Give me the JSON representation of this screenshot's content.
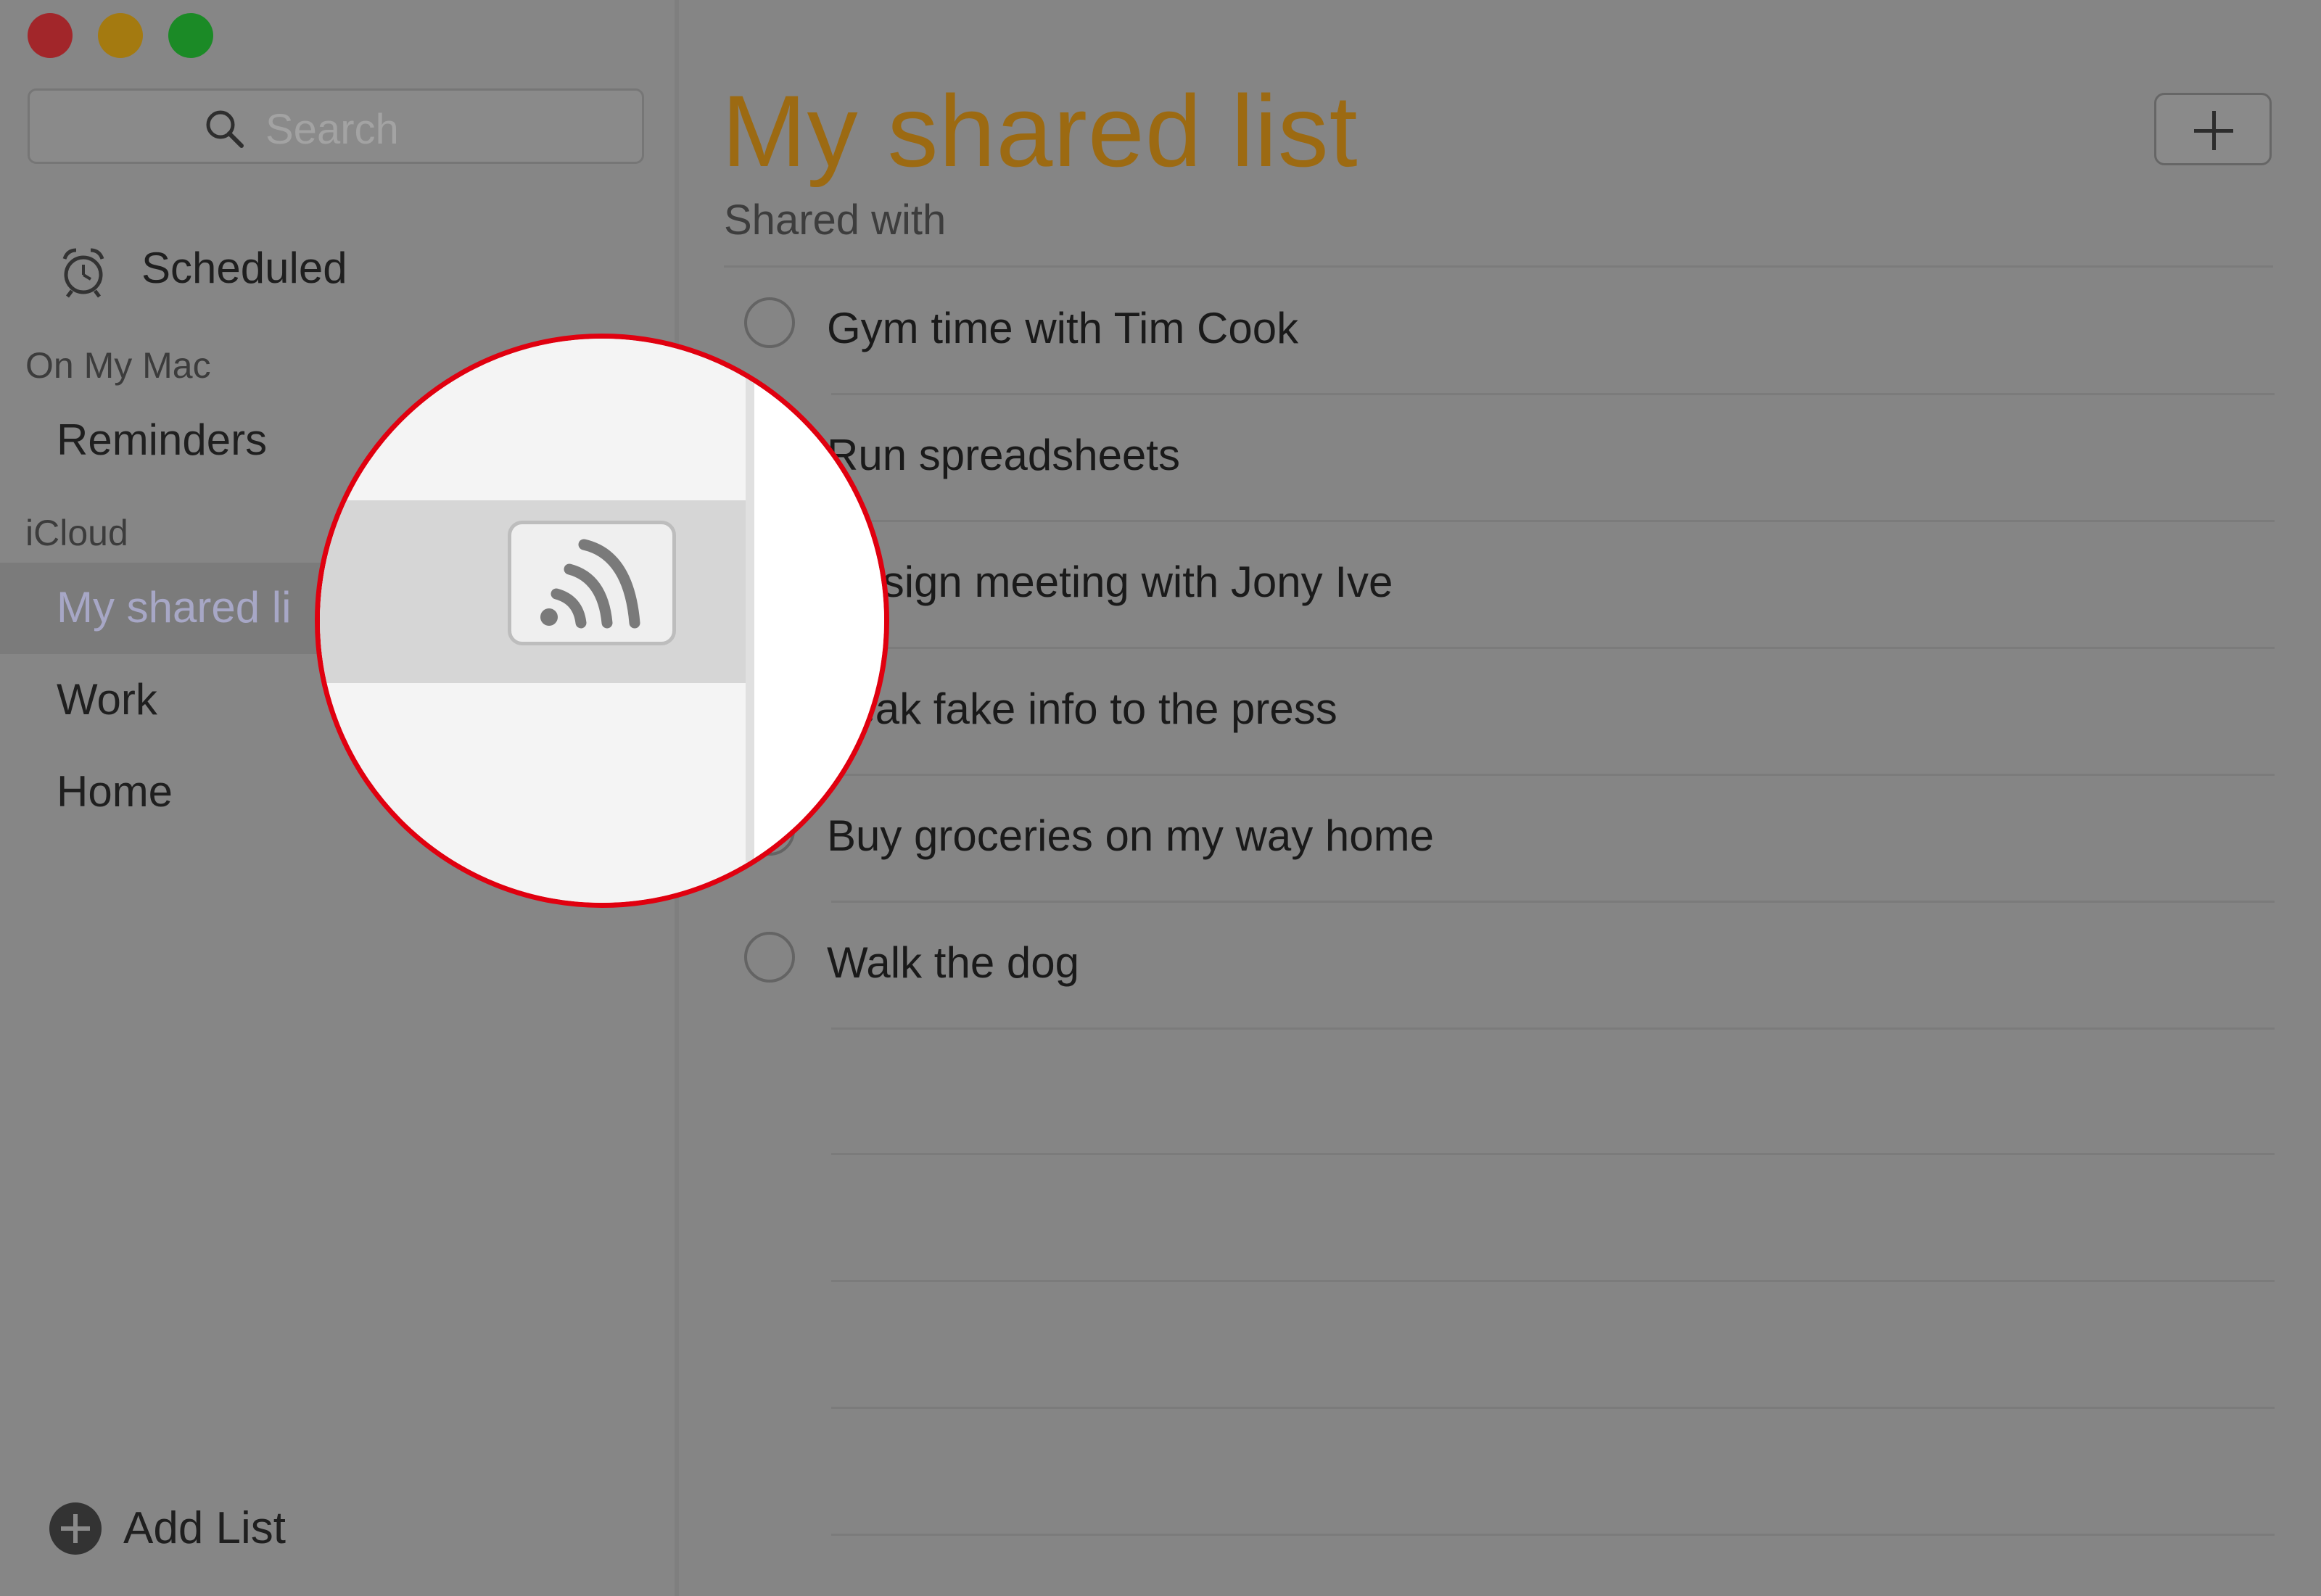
{
  "window": {
    "controls": [
      "close",
      "minimize",
      "zoom"
    ]
  },
  "sidebar": {
    "search_placeholder": "Search",
    "scheduled_label": "Scheduled",
    "sections": [
      {
        "title": "On My Mac",
        "items": [
          "Reminders"
        ]
      },
      {
        "title": "iCloud",
        "items": [
          "My shared list",
          "Work",
          "Home"
        ]
      }
    ],
    "selected_label_visible": "My shared li",
    "add_list_label": "Add List"
  },
  "main": {
    "title": "My shared list",
    "subtitle": "Shared with",
    "add_button_icon": "plus-icon",
    "reminders": [
      {
        "text": "Gym time with Tim Cook",
        "done": false
      },
      {
        "text": "Run spreadsheets",
        "done": false
      },
      {
        "text": "Design meeting with Jony Ive",
        "done": false
      },
      {
        "text": "Leak fake info to the press",
        "done": false
      },
      {
        "text": "Buy groceries on my way home",
        "done": false
      },
      {
        "text": "Walk the dog",
        "done": false
      }
    ]
  },
  "magnifier": {
    "highlighted_icon": "shared-list-broadcast-icon"
  },
  "colors": {
    "title_accent": "#9c6a12",
    "magnifier_ring": "#e0000f",
    "selected_row_text": "#a7a7c6"
  }
}
